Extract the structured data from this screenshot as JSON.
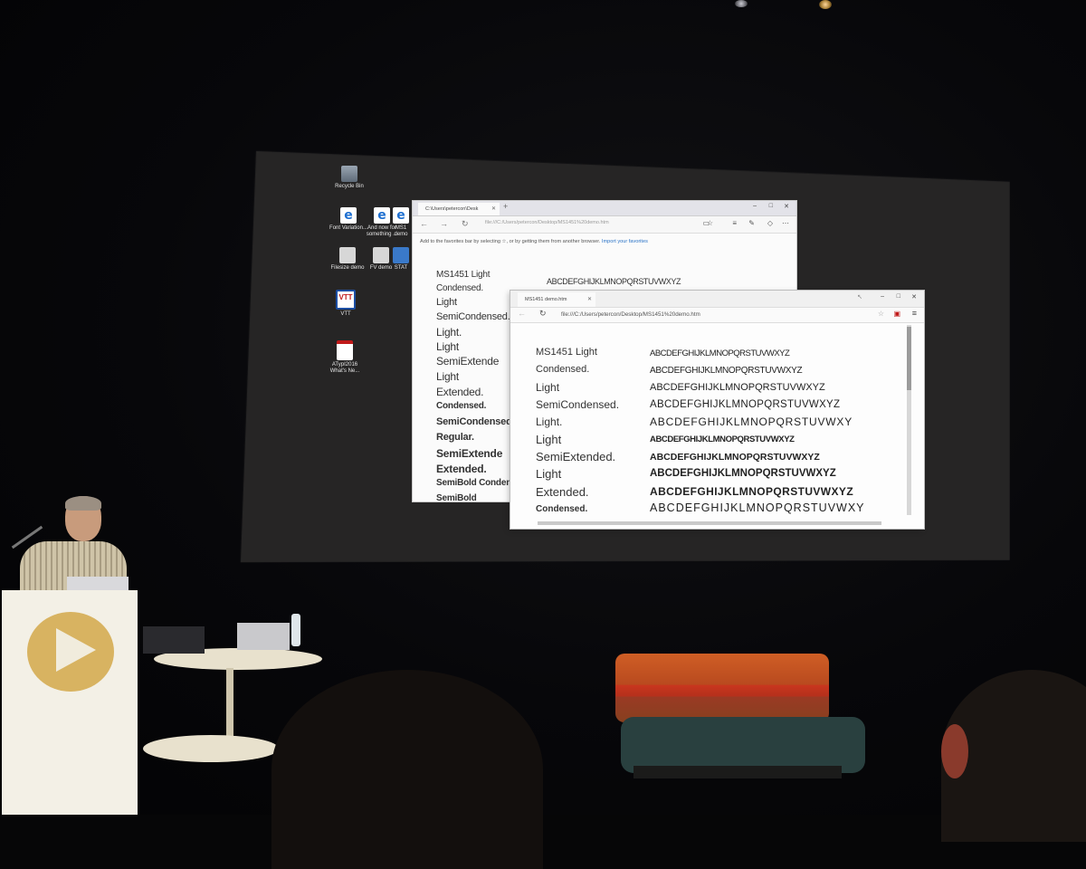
{
  "desktop": {
    "icons": [
      {
        "label": "Recycle Bin",
        "icon": "recycle-bin-icon"
      },
      {
        "label": "Font Variation...",
        "icon": "edge-file-icon"
      },
      {
        "label": "And now for something ...",
        "icon": "edge-file-icon"
      },
      {
        "label": "MS1 demo",
        "icon": "edge-file-icon"
      },
      {
        "label": "Filesize demo",
        "icon": "folder-house-icon"
      },
      {
        "label": "FV demo",
        "icon": "folder-house-icon"
      },
      {
        "label": "STAT",
        "icon": "stat-icon"
      },
      {
        "label": "VTT",
        "icon": "vtt-icon"
      },
      {
        "label": "ATypI2016 What's Ne...",
        "icon": "pdf-icon"
      }
    ]
  },
  "window_back": {
    "tab_title": "C:\\Users\\petercon\\Desk",
    "url": "file:///C:/Users/petercon/Desktop/MS1451%20demo.htm",
    "favorites_prompt": "Add to the favorites bar by selecting ☆, or by getting them from another browser.",
    "favorites_link": "Import your favorites",
    "alphabet": "ABCDEFGHIJKLMNOPQRSTUVWXYZ",
    "rows": [
      "MS1451 Light",
      "Condensed.",
      "Light",
      "SemiCondensed.",
      "Light.",
      "Light",
      "SemiExtende",
      "Light",
      "Extended.",
      "Condensed.",
      "SemiCondensed.",
      "Regular.",
      "SemiExtende",
      "Extended.",
      "SemiBold Condense",
      "SemiBold"
    ]
  },
  "window_front": {
    "tab_title": "MS1451 demo.htm",
    "url": "file:///C:/Users/petercon/Desktop/MS1451%20demo.htm",
    "rows": [
      {
        "name": "MS1451 Light",
        "sample": "ABCDEFGHIJKLMNOPQRSTUVWXYZ"
      },
      {
        "name": "Condensed.",
        "sample": "ABCDEFGHIJKLMNOPQRSTUVWXYZ"
      },
      {
        "name": "Light",
        "sample": "ABCDEFGHIJKLMNOPQRSTUVWXYZ"
      },
      {
        "name": "SemiCondensed.",
        "sample": "ABCDEFGHIJKLMNOPQRSTUVWXYZ"
      },
      {
        "name": "Light.",
        "sample": "ABCDEFGHIJKLMNOPQRSTUVWXY"
      },
      {
        "name": "Light",
        "sample": "ABCDEFGHIJKLMNOPQRSTUVWXYZ"
      },
      {
        "name": "SemiExtended.",
        "sample": "ABCDEFGHIJKLMNOPQRSTUVWXYZ"
      },
      {
        "name": "Light",
        "sample": "ABCDEFGHIJKLMNOPQRSTUVWXYZ"
      },
      {
        "name": "Extended.",
        "sample": "ABCDEFGHIJKLMNOPQRSTUVWXYZ"
      },
      {
        "name": "Condensed.",
        "sample": "ABCDEFGHIJKLMNOPQRSTUVWXY"
      }
    ]
  },
  "colors": {
    "screen": "#262525",
    "podium_logo": "#d8b361",
    "sofa_orange": "#c8501f",
    "sofa_seat": "#29403f"
  }
}
